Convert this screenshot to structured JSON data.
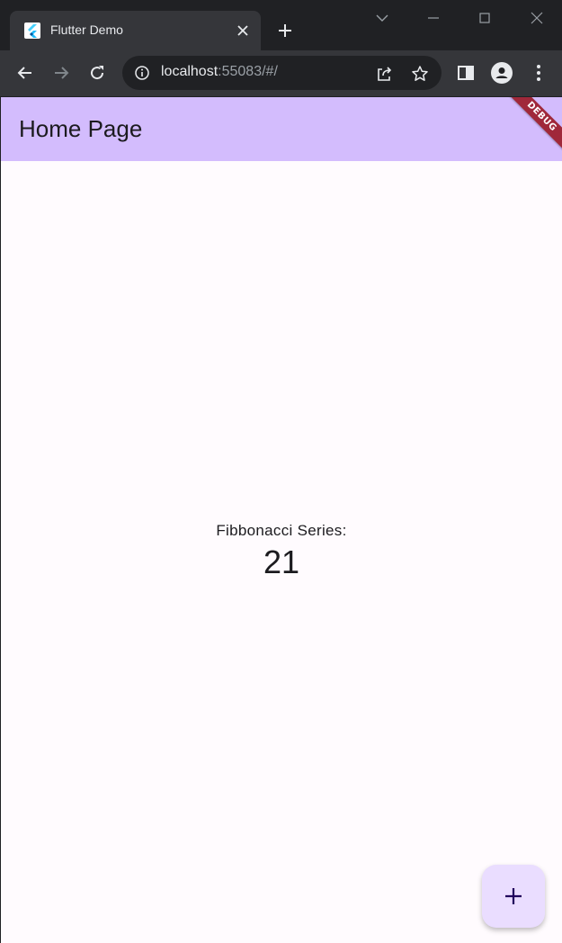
{
  "browser": {
    "tab": {
      "title": "Flutter Demo",
      "favicon": "flutter-logo-icon"
    },
    "new_tab_icon": "plus-icon",
    "address_bar": {
      "host": "localhost",
      "rest": ":55083/#/"
    }
  },
  "app": {
    "appbar_title": "Home Page",
    "debug_banner": "DEBUG",
    "label": "Fibbonacci Series:",
    "value": "21",
    "fab_icon": "add-icon"
  },
  "colors": {
    "appbar": "#d3bcfd",
    "background": "#fffbfe",
    "fab": "#eaddff",
    "debug_banner": "#a0283a"
  }
}
